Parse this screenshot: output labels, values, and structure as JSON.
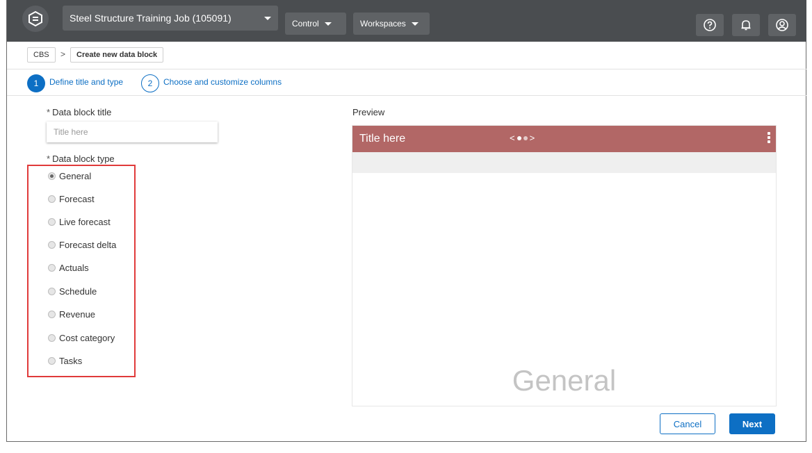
{
  "topbar": {
    "job_title": "Steel Structure Training Job (105091)",
    "control_label": "Control",
    "workspaces_label": "Workspaces"
  },
  "breadcrumb": {
    "root": "CBS",
    "separator": ">",
    "current": "Create new data block"
  },
  "steps": [
    {
      "number": "1",
      "label": "Define title and type",
      "active": true
    },
    {
      "number": "2",
      "label": "Choose and customize columns",
      "active": false
    }
  ],
  "form": {
    "title_label": "Data block title",
    "title_placeholder": "Title here",
    "title_value": "",
    "type_label": "Data block type",
    "required_mark": "*",
    "types": [
      {
        "label": "General",
        "selected": true
      },
      {
        "label": "Forecast",
        "selected": false
      },
      {
        "label": "Live forecast",
        "selected": false
      },
      {
        "label": "Forecast delta",
        "selected": false
      },
      {
        "label": "Actuals",
        "selected": false
      },
      {
        "label": "Schedule",
        "selected": false
      },
      {
        "label": "Revenue",
        "selected": false
      },
      {
        "label": "Cost category",
        "selected": false
      },
      {
        "label": "Tasks",
        "selected": false
      }
    ]
  },
  "preview": {
    "label": "Preview",
    "title": "Title here",
    "nav_prev": "<",
    "nav_next": ">",
    "type_text": "General",
    "header_color": "#b26766"
  },
  "buttons": {
    "cancel": "Cancel",
    "next": "Next"
  },
  "colors": {
    "accent": "#0d6fc4",
    "topbar": "#4a4d50",
    "highlight_box": "#e03a3a"
  }
}
